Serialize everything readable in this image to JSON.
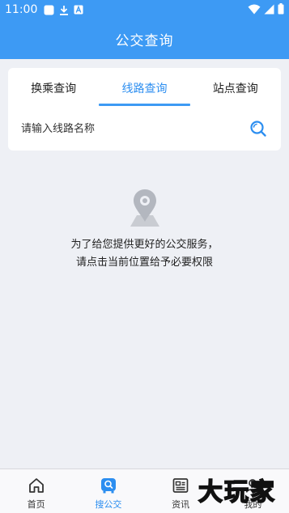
{
  "status_bar": {
    "time": "11:00",
    "icons": [
      "notification-square-icon",
      "download-icon",
      "font-a-icon"
    ],
    "right_icons": [
      "wifi-icon",
      "signal-icon",
      "battery-icon"
    ]
  },
  "header": {
    "title": "公交查询",
    "color": "#3d9af4"
  },
  "search_card": {
    "tabs": [
      {
        "label": "换乘查询",
        "active": false
      },
      {
        "label": "线路查询",
        "active": true
      },
      {
        "label": "站点查询",
        "active": false
      }
    ],
    "placeholder": "请输入线路名称",
    "search_icon": "search-icon"
  },
  "empty_state": {
    "icon": "map-location-pin-icon",
    "line1": "为了给您提供更好的公交服务，",
    "line2": "请点击当前位置给予必要权限"
  },
  "bottom_nav": {
    "items": [
      {
        "label": "首页",
        "icon": "home-icon",
        "active": false
      },
      {
        "label": "搜公交",
        "icon": "bus-search-icon",
        "active": true
      },
      {
        "label": "资讯",
        "icon": "news-icon",
        "active": false
      },
      {
        "label": "我的",
        "icon": "profile-icon",
        "active": false
      }
    ],
    "active_color": "#2c8ef0"
  },
  "watermark": {
    "text": "大玩家"
  }
}
